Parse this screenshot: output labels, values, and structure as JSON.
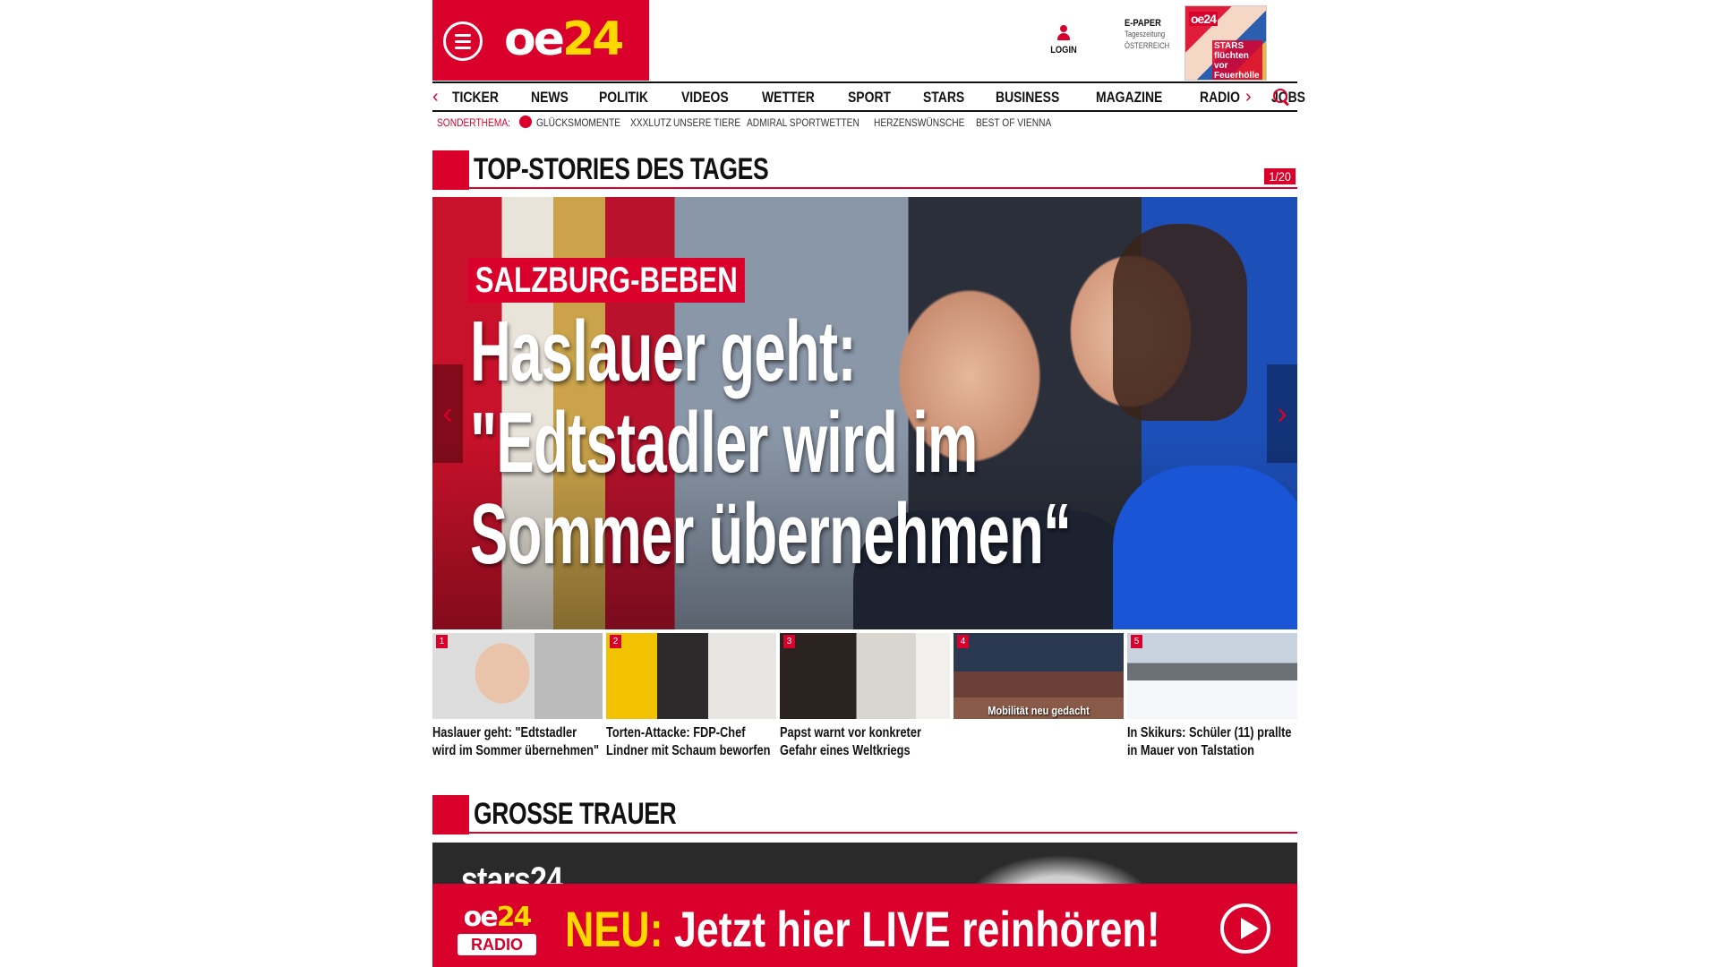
{
  "header": {
    "logo_text": "oe",
    "logo_num": "24",
    "login_label": "LOGIN",
    "epaper": {
      "title": "E-PAPER",
      "line2": "Tageszeitung",
      "line3": "ÖSTERREICH",
      "thumb_logo": "oe24",
      "thumb_caption": "STARS flüchten vor Feuerhölle"
    }
  },
  "nav": {
    "items": [
      "TICKER",
      "NEWS",
      "POLITIK",
      "VIDEOS",
      "WETTER",
      "SPORT",
      "STARS",
      "BUSINESS",
      "MAGAZINE",
      "RADIO",
      "JOBS"
    ],
    "left_arrow": "‹",
    "right_arrow": "›"
  },
  "subnav": {
    "label": "SONDERTHEMA:",
    "items": [
      "GLÜCKSMOMENTE",
      "XXXLUTZ",
      "UNSERE TIERE",
      "ADMIRAL SPORTWETTEN",
      "HERZENSWÜNSCHE",
      "BEST OF VIENNA"
    ]
  },
  "top_stories": {
    "title": "TOP-STORIES DES TAGES",
    "pager": "1/20",
    "hero": {
      "kicker": "SALZBURG-BEBEN",
      "headline_1": "Haslauer geht:",
      "headline_2": "\"Edtstadler wird im",
      "headline_3": "Sommer übernehmen“"
    },
    "thumbs": [
      {
        "num": "1",
        "caption": "Haslauer geht: \"Edtstadler wird im Sommer übernehmen\"",
        "overlay": ""
      },
      {
        "num": "2",
        "caption": "Torten-Attacke: FDP-Chef Lindner mit Schaum beworfen",
        "overlay": ""
      },
      {
        "num": "3",
        "caption": "Papst warnt vor konkreter Gefahr eines Weltkriegs",
        "overlay": ""
      },
      {
        "num": "4",
        "caption": "",
        "overlay": "Mobilität neu gedacht"
      },
      {
        "num": "5",
        "caption": "In Skikurs: Schüler (11) prallte in Mauer von Talstation",
        "overlay": ""
      }
    ]
  },
  "grosse_trauer": {
    "title": "GROSSE TRAUER",
    "brand": "stars24"
  },
  "radio_banner": {
    "logo_text": "oe",
    "logo_num": "24",
    "logo_sub": "RADIO",
    "highlight": "NEU:",
    "text": "Jetzt hier LIVE reinhören!"
  },
  "colors": {
    "brand_red": "#d9002b",
    "accent_yellow": "#ffd800"
  }
}
